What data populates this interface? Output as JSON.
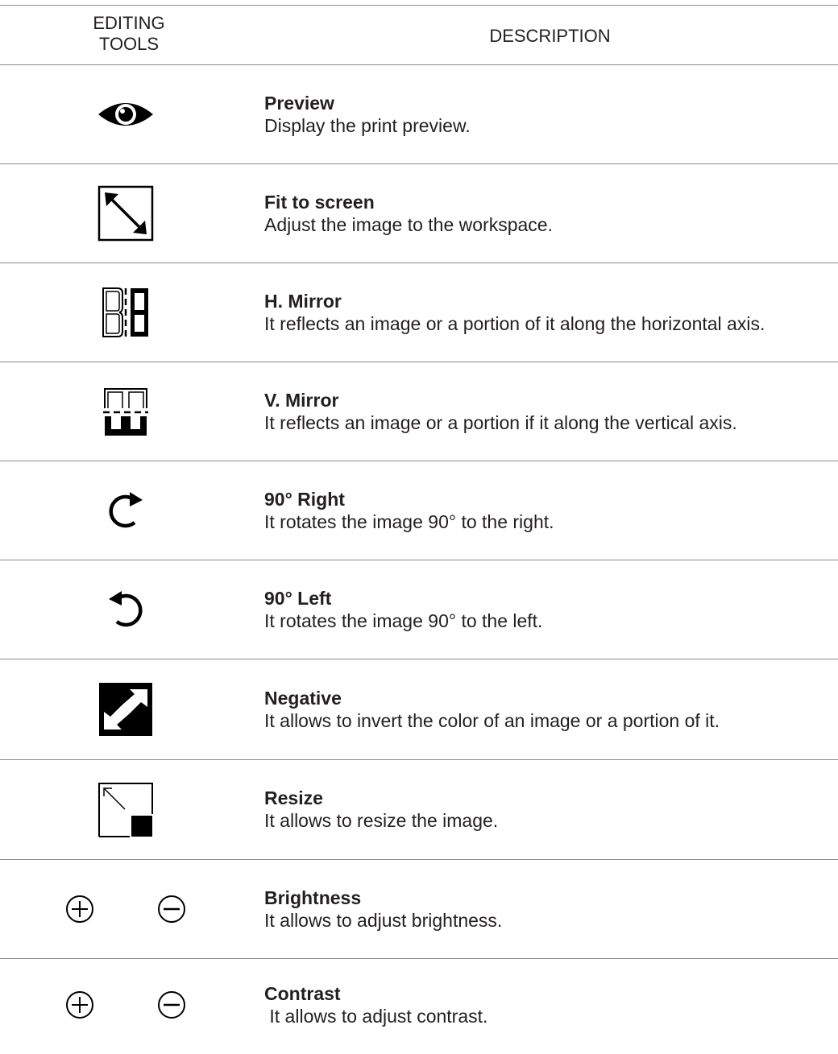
{
  "header": {
    "tools_label": "EDITING\nTOOLS",
    "tools_line1": "EDITING",
    "tools_line2": "TOOLS",
    "description_label": "DESCRIPTION"
  },
  "rows": [
    {
      "icon": "eye-icon",
      "title": "Preview",
      "text": "Display the print preview."
    },
    {
      "icon": "fit-to-screen-icon",
      "title": "Fit to screen",
      "text": "Adjust the image to the workspace."
    },
    {
      "icon": "horizontal-mirror-icon",
      "title": "H. Mirror",
      "text": "It reflects an image or a portion of it along the horizontal axis."
    },
    {
      "icon": "vertical-mirror-icon",
      "title": "V. Mirror",
      "text": "It reflects an image or a portion if it along the vertical axis."
    },
    {
      "icon": "rotate-right-icon",
      "title": "90° Right",
      "text": "It rotates the image 90° to the right."
    },
    {
      "icon": "rotate-left-icon",
      "title": "90° Left",
      "text": "It rotates the image 90° to the left."
    },
    {
      "icon": "negative-icon",
      "title": "Negative",
      "text": "It allows to invert the color of an image or a portion of it."
    },
    {
      "icon": "resize-icon",
      "title": "Resize",
      "text": "It allows to resize the image."
    },
    {
      "icon": "plus-minus-icons",
      "title": "Brightness",
      "text": "It allows to adjust brightness."
    },
    {
      "icon": "plus-minus-icons",
      "title": "Contrast",
      "text": " It allows to adjust contrast."
    }
  ]
}
